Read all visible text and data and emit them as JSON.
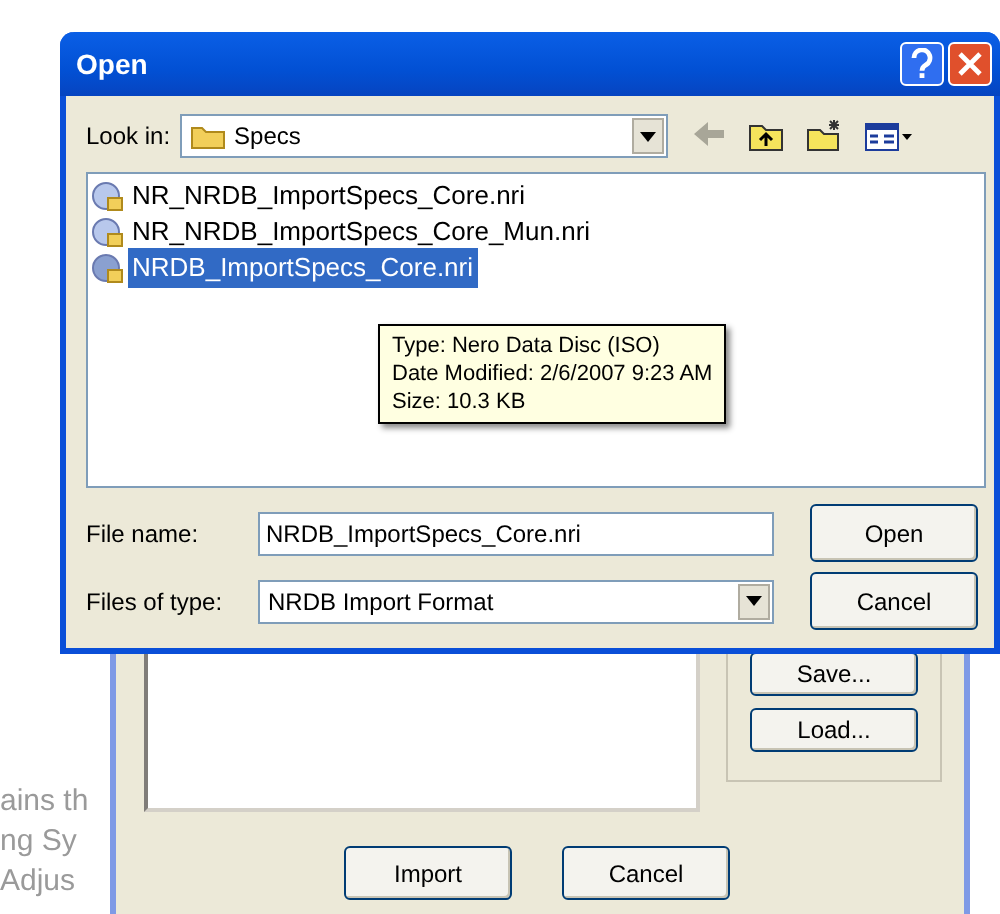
{
  "background_document": {
    "text_fragments": [
      "ains th",
      "ng Sy",
      "Adjus"
    ]
  },
  "import_dialog": {
    "side_buttons": [
      "Save...",
      "Load..."
    ],
    "bottom_buttons": [
      "Import",
      "Cancel"
    ]
  },
  "open_dialog": {
    "title": "Open",
    "look_in_label": "Look in:",
    "look_in_value": "Specs",
    "files": [
      {
        "name": "NR_NRDB_ImportSpecs_Core.nri",
        "selected": false
      },
      {
        "name": "NR_NRDB_ImportSpecs_Core_Mun.nri",
        "selected": false
      },
      {
        "name": "NRDB_ImportSpecs_Core.nri",
        "selected": true
      }
    ],
    "tooltip": [
      "Type: Nero Data Disc (ISO)",
      "Date Modified: 2/6/2007 9:23 AM",
      "Size: 10.3 KB"
    ],
    "file_name_label": "File name:",
    "file_name_value": "NRDB_ImportSpecs_Core.nri",
    "file_type_label": "Files of type:",
    "file_type_value": "NRDB Import Format",
    "buttons": [
      "Open",
      "Cancel"
    ]
  }
}
